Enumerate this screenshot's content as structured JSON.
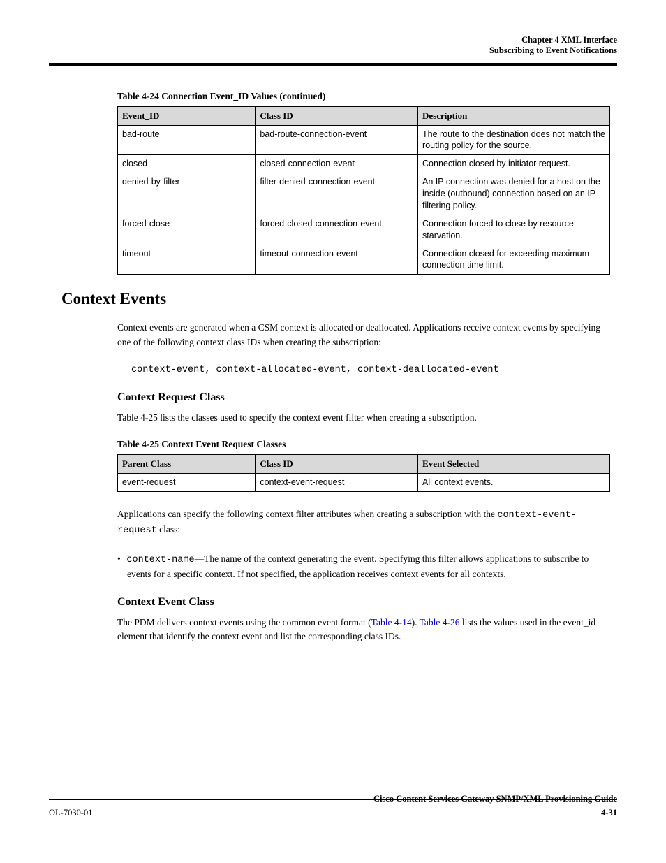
{
  "header": {
    "running_title": "Subscribing to Event Notifications"
  },
  "table1": {
    "caption": "Table 4-24  Connection Event_ID Values (continued)",
    "headers": [
      "Event_ID",
      "Class ID",
      "Description"
    ],
    "rows": [
      {
        "c1": "bad-route",
        "c2": "bad-route-connection-event",
        "c3": "The route to the destination does not match the routing policy for the source."
      },
      {
        "c1": "closed",
        "c2": "closed-connection-event",
        "c3": "Connection closed by initiator request."
      },
      {
        "c1": "denied-by-filter",
        "c2": "filter-denied-connection-event",
        "c3": "An IP connection was denied for a host on the inside (outbound) connection based on an IP filtering policy."
      },
      {
        "c1": "forced-close",
        "c2": "forced-closed-connection-event",
        "c3": "Connection forced to close by resource starvation."
      },
      {
        "c1": "timeout",
        "c2": "timeout-connection-event",
        "c3": "Connection closed for exceeding maximum connection time limit."
      }
    ]
  },
  "section": {
    "title": "Context Events",
    "p1": "Context events are generated when a CSM context is allocated or deallocated. Applications receive context events by specifying one of the following context class IDs when creating the subscription:",
    "p2_mono": "context-event, context-allocated-event, context-deallocated-event",
    "subheading": "Context Request Class",
    "p3": "Table 4-25 lists the classes used to specify the context event filter when creating a subscription."
  },
  "table2": {
    "caption": "Table 4-25  Context Event Request Classes",
    "headers": [
      "Parent Class",
      "Class ID",
      "Event Selected"
    ],
    "rows": [
      {
        "c1": "event-request",
        "c2": "context-event-request",
        "c3": "All context events."
      }
    ]
  },
  "body2": {
    "p4_prefix": "Applications can specify the following context filter attributes when creating a subscription with the ",
    "p4_code": "context-event-request",
    "p4_suffix": " class:",
    "bullet_code": "context-name",
    "bullet_text": "—The name of the context generating the event. Specifying this filter allows applications to subscribe to events for a specific context. If not specified, the application receives context events for all contexts.",
    "subheading2": "Context Event Class",
    "p5_prefix": "The PDM delivers context events using the common event format (",
    "p5_link": "Table 4-14",
    "p5_mid": "). ",
    "p5_link2": "Table 4-26",
    "p5_suffix": " lists the values used in the event_id element that identify the context event and list the corresponding class IDs."
  },
  "footer": {
    "left": "OL-7030-01",
    "center": "Cisco Content Services Gateway SNMP/XML Provisioning Guide",
    "page": "4-31"
  }
}
